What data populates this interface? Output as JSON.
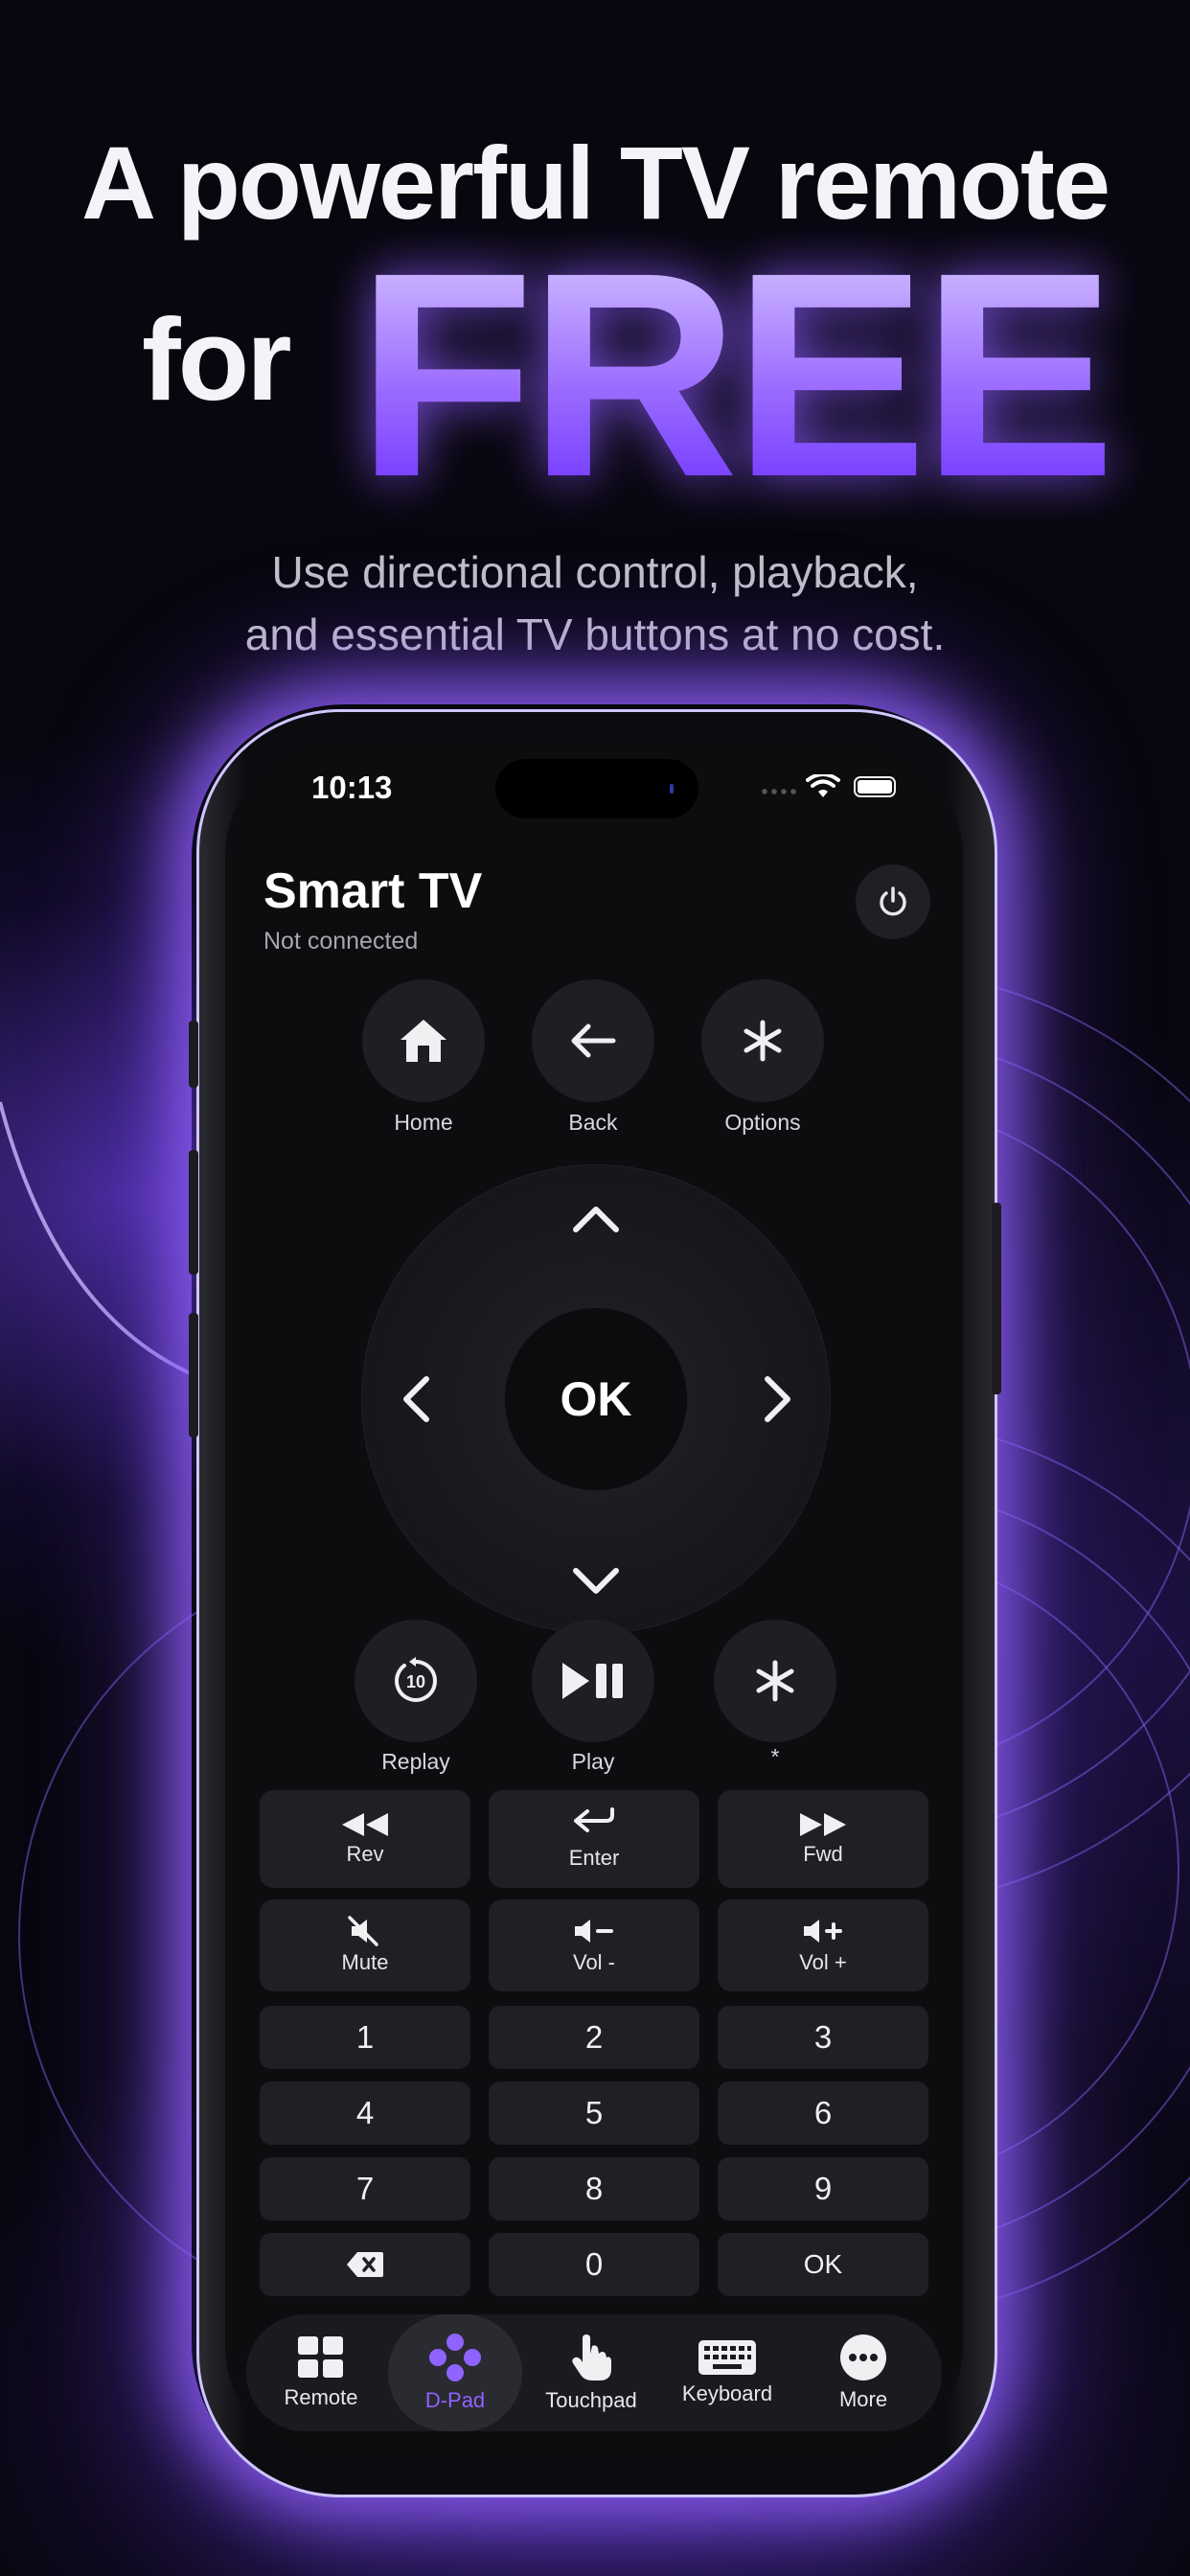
{
  "colors": {
    "accent": "#8e63ff",
    "background": "#07050c",
    "button": "#1f1f24"
  },
  "hero": {
    "line1": "A powerful TV remote",
    "line2_prefix": "for",
    "line2_highlight": "FREE",
    "subtitle_line1": "Use directional control, playback,",
    "subtitle_line2": "and essential TV buttons at no cost."
  },
  "status_bar": {
    "time": "10:13",
    "icons": [
      "cellular-dots-icon",
      "wifi-icon",
      "battery-icon"
    ]
  },
  "header": {
    "device_name": "Smart TV",
    "connection_status": "Not connected",
    "power_icon": "power-icon"
  },
  "nav_buttons": [
    {
      "label": "Home",
      "icon": "home-icon"
    },
    {
      "label": "Back",
      "icon": "back-arrow-icon"
    },
    {
      "label": "Options",
      "icon": "asterisk-icon"
    }
  ],
  "dpad": {
    "ok_label": "OK"
  },
  "playback_buttons": [
    {
      "label": "Replay",
      "icon": "replay-10-icon"
    },
    {
      "label": "Play",
      "icon": "play-pause-icon"
    },
    {
      "label": "*",
      "icon": "asterisk-icon"
    }
  ],
  "control_tiles": [
    {
      "label": "Rev",
      "icon": "rewind-icon"
    },
    {
      "label": "Enter",
      "icon": "enter-icon"
    },
    {
      "label": "Fwd",
      "icon": "fast-forward-icon"
    },
    {
      "label": "Mute",
      "icon": "mute-icon"
    },
    {
      "label": "Vol -",
      "icon": "volume-down-icon"
    },
    {
      "label": "Vol +",
      "icon": "volume-up-icon"
    }
  ],
  "keypad": [
    "1",
    "2",
    "3",
    "4",
    "5",
    "6",
    "7",
    "8",
    "9",
    "",
    "0",
    "OK"
  ],
  "keypad_delete_icon": "delete-icon",
  "tabs": [
    {
      "label": "Remote",
      "icon": "grid-icon",
      "active": false
    },
    {
      "label": "D-Pad",
      "icon": "dpad-icon",
      "active": true
    },
    {
      "label": "Touchpad",
      "icon": "hand-pointer-icon",
      "active": false
    },
    {
      "label": "Keyboard",
      "icon": "keyboard-icon",
      "active": false
    },
    {
      "label": "More",
      "icon": "more-icon",
      "active": false
    }
  ]
}
